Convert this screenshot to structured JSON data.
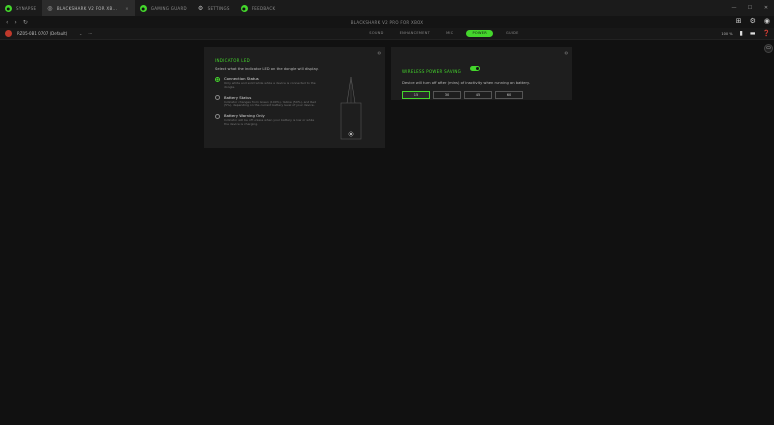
{
  "tabs": [
    {
      "label": "SYNAPSE",
      "active": false
    },
    {
      "label": "BLACKSHARK V2 FOR XB...",
      "active": true
    },
    {
      "label": "GAMING GUARD",
      "active": false
    },
    {
      "label": "SETTINGS",
      "active": false
    },
    {
      "label": "FEEDBACK",
      "active": false
    }
  ],
  "window": {
    "title": "BLACKSHARK V2 PRO FOR XBOX"
  },
  "device": {
    "profile": "RZ05-0B1 0707 (Default)",
    "battery": "100 %",
    "subtabs": [
      "SOUND",
      "ENHANCEMENT",
      "MIC",
      "POWER",
      "GUIDE"
    ],
    "active_subtab": "POWER"
  },
  "indicator": {
    "title": "INDICATOR LED",
    "desc": "Select what the indicator LED on the dongle will display.",
    "options": [
      {
        "label": "Connection Status",
        "sub": "Only white and solid while while a device is connected to the dongle.",
        "selected": true
      },
      {
        "label": "Battery Status",
        "sub": "Indicator changes from Green (100%), Yellow (50%), and Red (5%), depending on the current battery level of your device.",
        "selected": false
      },
      {
        "label": "Battery Warning Only",
        "sub": "Indicator will be off unless when your battery is low or while the device is charging.",
        "selected": false
      }
    ]
  },
  "wireless": {
    "title": "WIRELESS POWER SAVING",
    "enabled": true,
    "desc": "Device will turn off after (mins) of inactivity when running on battery.",
    "options": [
      "15",
      "30",
      "45",
      "60"
    ],
    "selected": "15"
  },
  "colors": {
    "accent": "#44d62c"
  }
}
